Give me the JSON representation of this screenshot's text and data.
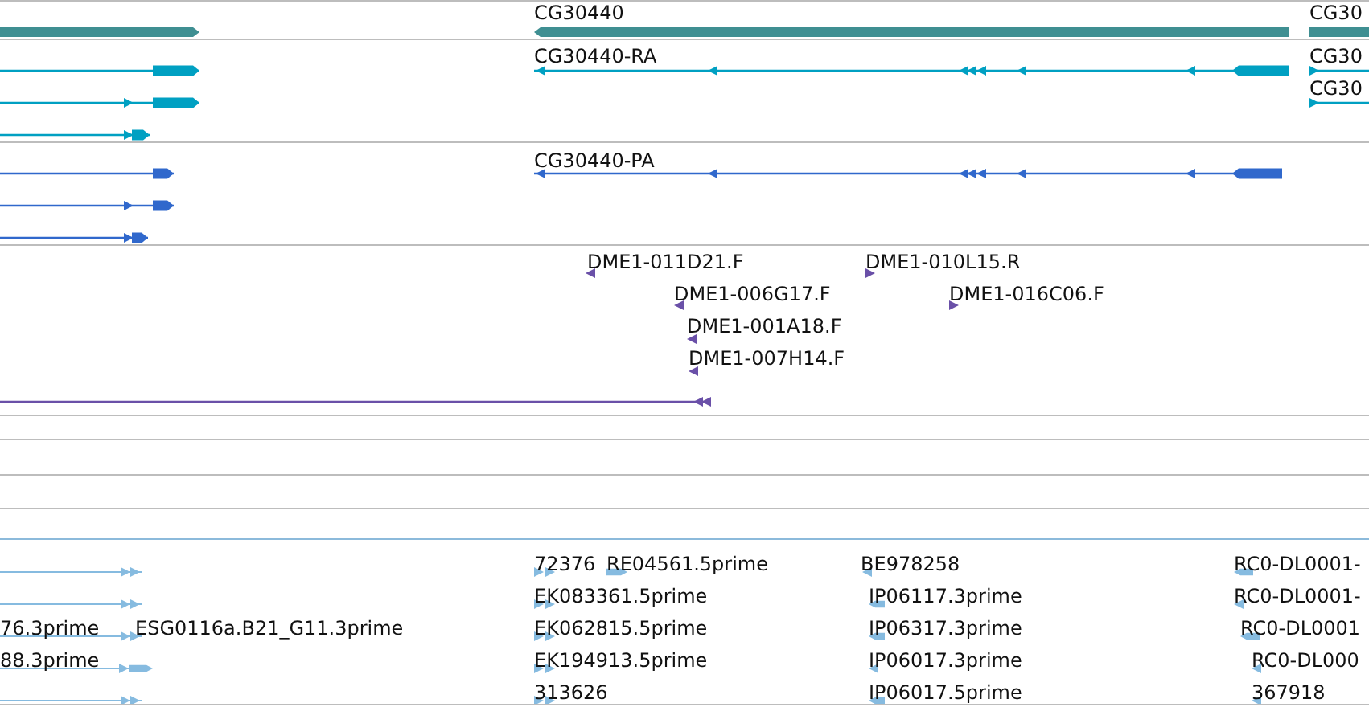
{
  "tracks": [
    {
      "kind": "gene",
      "color": "#3f8f92",
      "features": [
        {
          "reverse": false
        },
        {
          "label": "CG30440",
          "reverse": true
        },
        {
          "label": "CG30"
        }
      ]
    },
    {
      "kind": "transcript",
      "color": "#00a0c2",
      "features": [
        {
          "reverse": false
        },
        {
          "reverse": false
        },
        {
          "reverse": false
        },
        {
          "label": "CG30440-RA",
          "reverse": true
        },
        {
          "label": "CG30",
          "reverse": false
        },
        {
          "label": "CG30",
          "reverse": false
        }
      ]
    },
    {
      "kind": "transcript",
      "color": "#3068cc",
      "features": [
        {
          "reverse": false
        },
        {
          "reverse": false
        },
        {
          "reverse": false
        },
        {
          "label": "CG30440-PA",
          "reverse": true
        }
      ]
    },
    {
      "kind": "marker",
      "color": "#6a50a8",
      "features": [
        {
          "label": "DME1-011D21.F",
          "reverse": true
        },
        {
          "label": "DME1-010L15.R",
          "reverse": false
        },
        {
          "label": "DME1-006G17.F",
          "reverse": true
        },
        {
          "label": "DME1-016C06.F",
          "reverse": false
        },
        {
          "label": "DME1-001A18.F",
          "reverse": true
        },
        {
          "label": "DME1-007H14.F",
          "reverse": true
        },
        {
          "reverse": true
        }
      ]
    },
    {
      "kind": "alignment",
      "color": "#86bbe0",
      "features": [
        {
          "reverse": false
        },
        {
          "reverse": false
        },
        {
          "reverse": false
        },
        {
          "label": "76.3prime",
          "reverse": false
        },
        {
          "label": "ESG0116a.B21_G11.3prime",
          "reverse": false
        },
        {
          "label": "88.3prime",
          "reverse": false
        },
        {
          "label": "72376",
          "reverse": false
        },
        {
          "label": "RE04561.5prime",
          "reverse": false
        },
        {
          "label": "EK083361.5prime",
          "reverse": false
        },
        {
          "label": "EK062815.5prime",
          "reverse": false
        },
        {
          "label": "EK194913.5prime",
          "reverse": false
        },
        {
          "label": "313626",
          "reverse": false
        },
        {
          "label": "BE978258",
          "reverse": true
        },
        {
          "label": "IP06117.3prime",
          "reverse": true
        },
        {
          "label": "IP06317.3prime",
          "reverse": true
        },
        {
          "label": "IP06017.3prime",
          "reverse": true
        },
        {
          "label": "IP06017.5prime",
          "reverse": true
        },
        {
          "label": "RC0-DL0001-",
          "reverse": true
        },
        {
          "label": "RC0-DL0001-",
          "reverse": true
        },
        {
          "label": "RC0-DL0001",
          "reverse": true
        },
        {
          "label": "RC0-DL000",
          "reverse": true
        },
        {
          "label": "367918",
          "reverse": true
        }
      ]
    }
  ]
}
